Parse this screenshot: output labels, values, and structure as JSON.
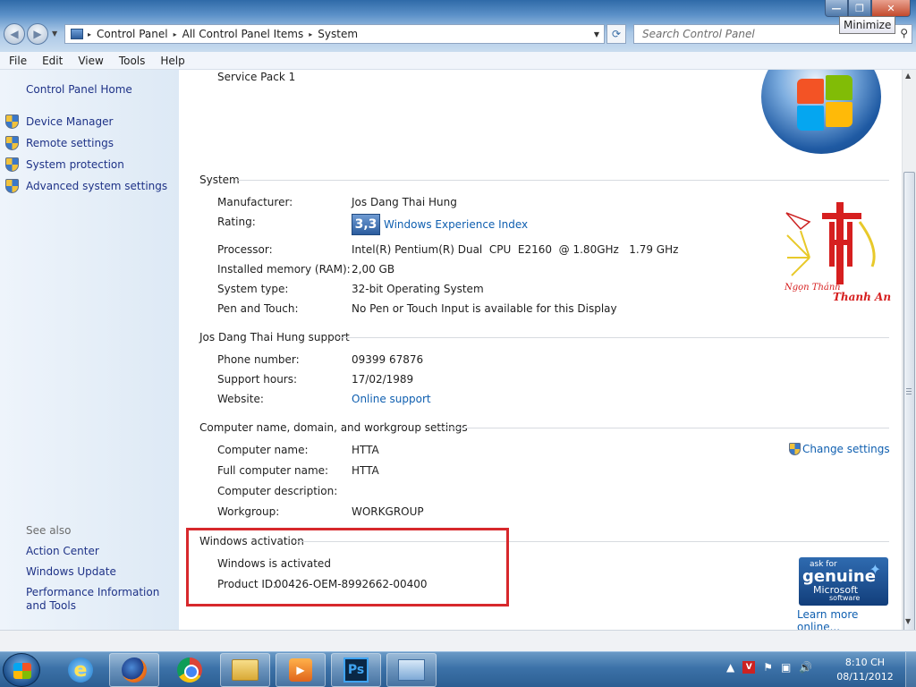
{
  "window": {
    "min_glyph": "—",
    "max_glyph": "❐",
    "close_glyph": "✕",
    "tooltip": "Minimize"
  },
  "address": {
    "segments": [
      "Control Panel",
      "All Control Panel Items",
      "System"
    ],
    "separator": "▸",
    "dropdown": "▼"
  },
  "search": {
    "placeholder": "Search Control Panel"
  },
  "menu": [
    "File",
    "Edit",
    "View",
    "Tools",
    "Help"
  ],
  "sidebar": {
    "home": "Control Panel Home",
    "items": [
      {
        "label": "Device Manager",
        "icon": "shield-icon"
      },
      {
        "label": "Remote settings",
        "icon": "shield-icon"
      },
      {
        "label": "System protection",
        "icon": "shield-icon"
      },
      {
        "label": "Advanced system settings",
        "icon": "shield-icon"
      }
    ],
    "see_also_label": "See also",
    "see_also": [
      "Action Center",
      "Windows Update",
      "Performance Information and Tools"
    ]
  },
  "main": {
    "service_pack": "Service Pack 1",
    "system": {
      "heading": "System",
      "manufacturer_label": "Manufacturer:",
      "manufacturer": "Jos Dang Thai Hung",
      "rating_label": "Rating:",
      "rating_score": "3,3",
      "rating_link": "Windows Experience Index",
      "processor_label": "Processor:",
      "processor": "Intel(R) Pentium(R) Dual  CPU  E2160  @ 1.80GHz   1.79 GHz",
      "memory_label": "Installed memory (RAM):",
      "memory": "2,00 GB",
      "type_label": "System type:",
      "type": "32-bit Operating System",
      "pen_label": "Pen and Touch:",
      "pen": "No Pen or Touch Input is available for this Display"
    },
    "support": {
      "heading": "Jos Dang Thai Hung support",
      "phone_label": "Phone number:",
      "phone": "09399 67876",
      "hours_label": "Support hours:",
      "hours": "17/02/1989",
      "website_label": "Website:",
      "website": "Online support"
    },
    "computer": {
      "heading": "Computer name, domain, and workgroup settings",
      "name_label": "Computer name:",
      "name": "HTTA",
      "fullname_label": "Full computer name:",
      "fullname": "HTTA",
      "desc_label": "Computer description:",
      "workgroup_label": "Workgroup:",
      "workgroup": "WORKGROUP",
      "change_settings": "Change settings"
    },
    "activation": {
      "heading": "Windows activation",
      "status": "Windows is activated",
      "product_id_label": "Product ID:",
      "product_id": "00426-OEM-8992662-00400",
      "genuine_line1": "ask for",
      "genuine_line2": "genuine",
      "genuine_line3": "Microsoft",
      "genuine_line4": "software",
      "learn_more": "Learn more online..."
    },
    "logo_text": "Thanh An",
    "logo_subtext": "Ngọn Thánh"
  },
  "taskbar": {
    "apps": [
      "internet-explorer",
      "firefox",
      "chrome",
      "windows-explorer",
      "media-player",
      "photoshop",
      "control-panel"
    ],
    "ie_glyph": "e",
    "ps_glyph": "Ps",
    "tray_av_glyph": "V",
    "clock_time": "8:10 CH",
    "clock_date": "08/11/2012"
  },
  "colors": {
    "link": "#0f5fb0",
    "nav_link": "#1e3287",
    "highlight_box": "#d7282c"
  }
}
